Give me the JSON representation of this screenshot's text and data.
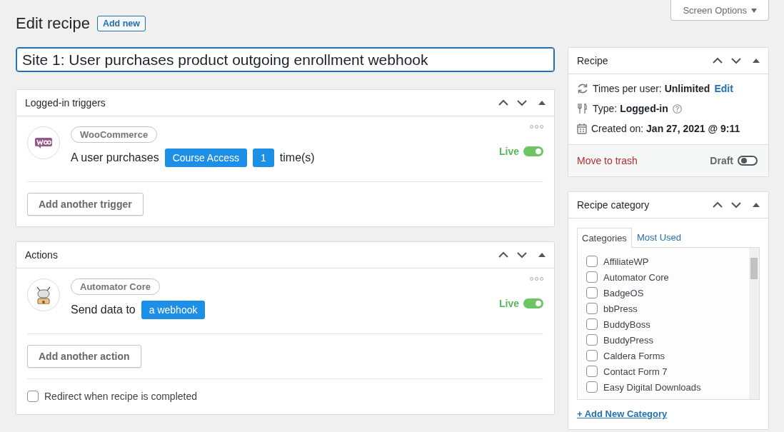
{
  "screen_options": {
    "label": "Screen Options"
  },
  "heading": {
    "title": "Edit recipe",
    "add_new": "Add new"
  },
  "title_field": {
    "value": "Site 1: User purchases product outgoing enrollment webhook"
  },
  "panels": [
    {
      "title": "Logged-in triggers",
      "integration": "WooCommerce",
      "sentence": [
        {
          "kind": "text",
          "text": "A user purchases"
        },
        {
          "kind": "token",
          "text": "Course Access"
        },
        {
          "kind": "token",
          "text": "1"
        },
        {
          "kind": "text",
          "text": "time(s)"
        }
      ],
      "status": "Live",
      "on": true,
      "add_button": "Add another trigger"
    },
    {
      "title": "Actions",
      "integration": "Automator Core",
      "sentence": [
        {
          "kind": "text",
          "text": "Send data to"
        },
        {
          "kind": "token",
          "text": "a webhook"
        }
      ],
      "status": "Live",
      "on": true,
      "add_button": "Add another action",
      "redirect": {
        "label": "Redirect when recipe is completed",
        "checked": false
      }
    }
  ],
  "recipe_box": {
    "title": "Recipe",
    "rows": [
      {
        "kind": "refresh",
        "label": "Times per user:",
        "value": "Unlimited",
        "link": "Edit"
      },
      {
        "kind": "type",
        "label": "Type:",
        "value": "Logged-in",
        "help": true
      },
      {
        "kind": "calendar",
        "label": "Created on:",
        "value": "Jan 27, 2021 @ 9:11"
      }
    ],
    "trash": "Move to trash",
    "status": "Draft",
    "on": false
  },
  "category_box": {
    "title": "Recipe category",
    "tabs": [
      {
        "label": "Categories",
        "selected": true
      },
      {
        "label": "Most Used",
        "selected": false
      }
    ],
    "items": [
      {
        "label": "AffiliateWP",
        "checked": false
      },
      {
        "label": "Automator Core",
        "checked": false
      },
      {
        "label": "BadgeOS",
        "checked": false
      },
      {
        "label": "bbPress",
        "checked": false
      },
      {
        "label": "BuddyBoss",
        "checked": false
      },
      {
        "label": "BuddyPress",
        "checked": false
      },
      {
        "label": "Caldera Forms",
        "checked": false
      },
      {
        "label": "Contact Form 7",
        "checked": false
      },
      {
        "label": "Easy Digital Downloads",
        "checked": false
      }
    ],
    "add_link": "+ Add New Category"
  }
}
